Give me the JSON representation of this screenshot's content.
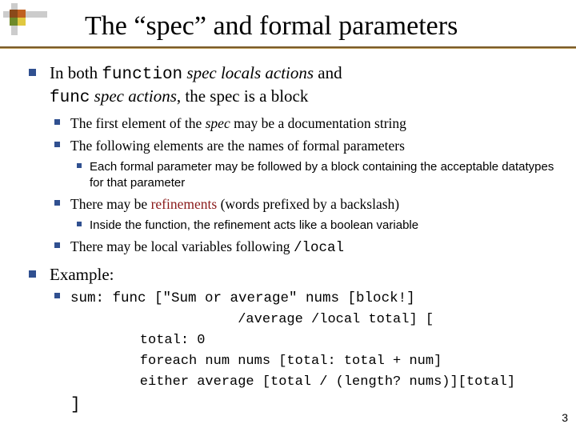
{
  "title": "The “spec” and formal parameters",
  "l1a_pre": "In both ",
  "l1a_fn": "function",
  "l1a_mid1": " ",
  "l1a_spec": "spec locals actions",
  "l1a_and": " and",
  "l1b_fn": "func",
  "l1b_mid": " ",
  "l1b_spec": "spec actions",
  "l1b_post": ", the spec is a block",
  "l2a_pre": "The first element of the ",
  "l2a_spec": "spec",
  "l2a_post": " may be a documentation string",
  "l2b": "The following elements are the names of formal parameters",
  "l3a": "Each formal parameter may be followed by a block containing the acceptable datatypes for that parameter",
  "l2c_pre": "There may be ",
  "l2c_ref": "refinements",
  "l2c_post": " (words prefixed by a backslash)",
  "l3b": "Inside the function, the refinement acts like a boolean variable",
  "l2d_pre": "There may be local variables following  ",
  "l2d_local": "/local",
  "l1c": "Example:",
  "code1": "sum: func [\"Sum or average\" nums [block!]",
  "code2": "                /average /local total] [",
  "code3": "    total: 0",
  "code4": "    foreach num nums [total: total + num]",
  "code5": "    either average [total / (length? nums)][total]",
  "code6": "]",
  "page": "3"
}
